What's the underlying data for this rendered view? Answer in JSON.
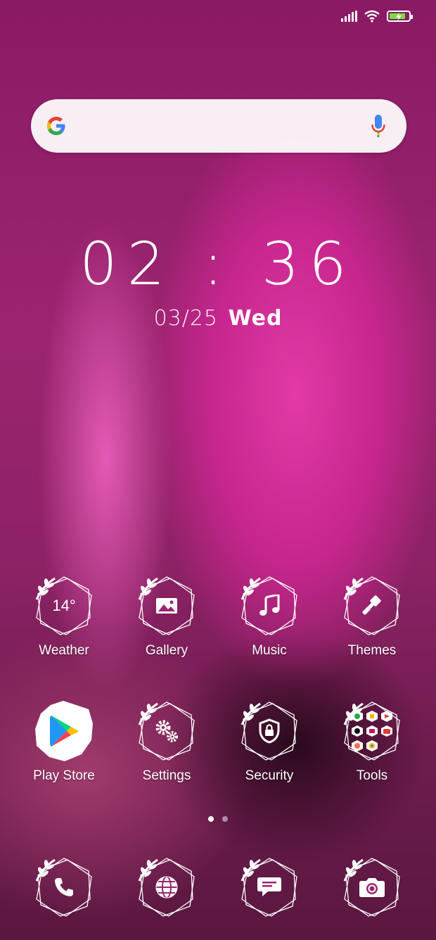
{
  "status_bar": {
    "signal_icon": "signal-icon",
    "wifi_icon": "wifi-icon",
    "battery_icon": "battery-charging-icon",
    "battery_color": "#7cdc3a"
  },
  "search": {
    "logo": "google-icon",
    "mic": "microphone-icon"
  },
  "clock": {
    "time": "02 : 36",
    "date": "03/25",
    "weekday": "Wed"
  },
  "home_apps": [
    {
      "label": "Weather",
      "icon": "weather-icon",
      "value": "14°"
    },
    {
      "label": "Gallery",
      "icon": "gallery-icon"
    },
    {
      "label": "Music",
      "icon": "music-icon"
    },
    {
      "label": "Themes",
      "icon": "themes-icon"
    },
    {
      "label": "Play Store",
      "icon": "play-store-icon"
    },
    {
      "label": "Settings",
      "icon": "settings-icon"
    },
    {
      "label": "Security",
      "icon": "security-icon"
    },
    {
      "label": "Tools",
      "icon": "tools-folder-icon"
    }
  ],
  "page_indicator": {
    "pages": 2,
    "current": 1
  },
  "dock": [
    {
      "icon": "phone-icon"
    },
    {
      "icon": "browser-icon"
    },
    {
      "icon": "messages-icon"
    },
    {
      "icon": "camera-icon"
    }
  ]
}
